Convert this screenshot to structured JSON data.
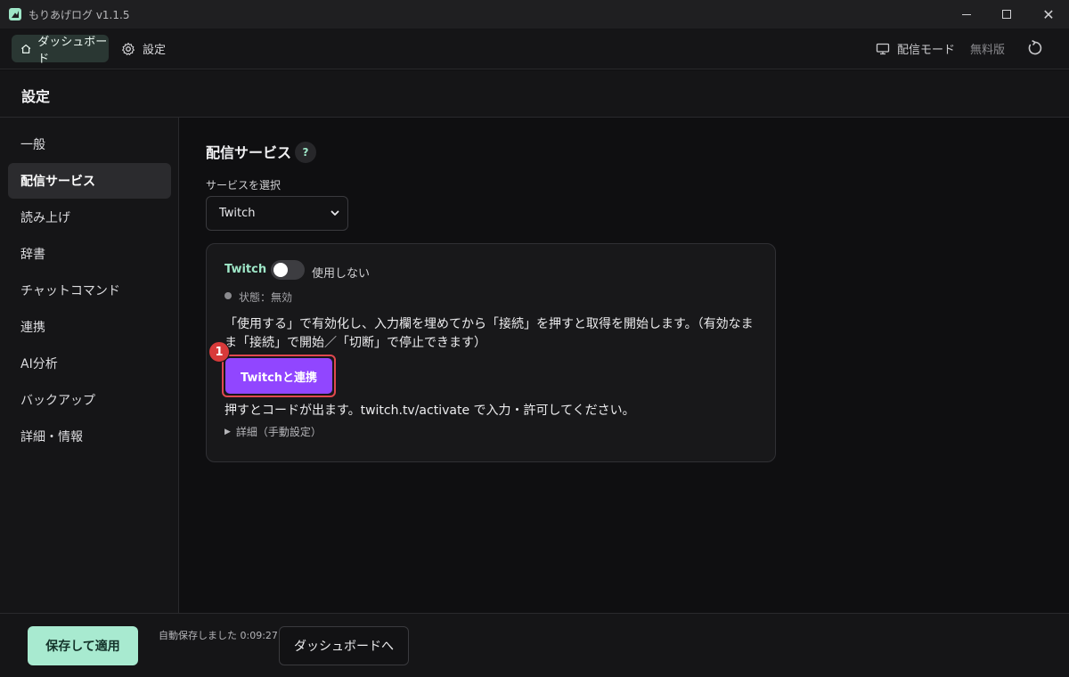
{
  "window": {
    "title": "もりあげログ v1.1.5",
    "controls": {
      "minimize": "minimize-icon",
      "maximize": "maximize-icon",
      "close": "✕"
    }
  },
  "topnav": {
    "dashboard_label": "ダッシュボード",
    "settings_label": "設定",
    "broadcast_mode_label": "配信モード",
    "plan_label": "無料版"
  },
  "page": {
    "title": "設定"
  },
  "sidebar": {
    "items": [
      {
        "label": "一般",
        "active": false
      },
      {
        "label": "配信サービス",
        "active": true
      },
      {
        "label": "読み上げ",
        "active": false
      },
      {
        "label": "辞書",
        "active": false
      },
      {
        "label": "チャットコマンド",
        "active": false
      },
      {
        "label": "連携",
        "active": false
      },
      {
        "label": "AI分析",
        "active": false
      },
      {
        "label": "バックアップ",
        "active": false
      },
      {
        "label": "詳細・情報",
        "active": false
      }
    ]
  },
  "main": {
    "section_title": "配信サービス",
    "help_label": "?",
    "select_label": "サービスを選択",
    "select_value": "Twitch",
    "card": {
      "service_name": "Twitch",
      "toggle_on": false,
      "toggle_label": "使用しない",
      "status_text": "状態：無効",
      "description": "「使用する」で有効化し、入力欄を埋めてから「接続」を押すと取得を開始します。（有効なまま「接続」で開始／「切断」で停止できます）",
      "step_badge": "1",
      "connect_button": "Twitchと連携",
      "hint": "押すとコードが出ます。twitch.tv/activate で入力・許可してください。",
      "details_label": "詳細（手動設定）"
    }
  },
  "bottombar": {
    "save_button": "保存して適用",
    "autosave_text": "自動保存しました 0:09:27",
    "dashboard_button": "ダッシュボードへ"
  },
  "colors": {
    "accent": "#9ee6c7",
    "twitch": "#9146ff",
    "highlight": "#e0484f",
    "save_button": "#a8ead0"
  }
}
